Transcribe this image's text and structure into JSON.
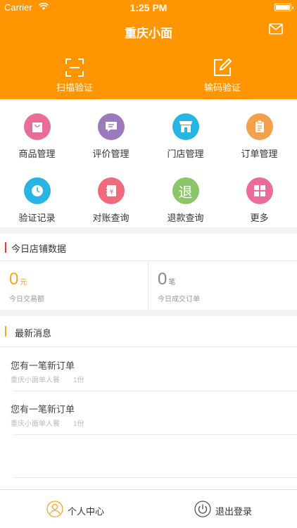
{
  "status_bar": {
    "carrier": "Carrier",
    "time": "1:25 PM"
  },
  "header": {
    "title": "重庆小面",
    "scan_label": "扫描验证",
    "code_label": "输码验证"
  },
  "grid": {
    "items": [
      {
        "label": "商品管理",
        "icon": "bag-icon",
        "color": "#ea6c98"
      },
      {
        "label": "评价管理",
        "icon": "message-icon",
        "color": "#9b79bd"
      },
      {
        "label": "门店管理",
        "icon": "store-icon",
        "color": "#29b5e3"
      },
      {
        "label": "订单管理",
        "icon": "clipboard-icon",
        "color": "#f5a04b"
      },
      {
        "label": "验证记录",
        "icon": "clock-icon",
        "color": "#29b5e3"
      },
      {
        "label": "对账查询",
        "icon": "ledger-icon",
        "color": "#ef6a7a"
      },
      {
        "label": "退款查询",
        "icon": "refund-icon",
        "glyph": "退",
        "color": "#8ac56a"
      },
      {
        "label": "更多",
        "icon": "more-grid-icon",
        "color": "#ea6c98"
      }
    ]
  },
  "today": {
    "title": "今日店铺数据",
    "accent": "#e53935",
    "trade_value": "0",
    "trade_unit": "元",
    "trade_label": "今日交易额",
    "trade_color": "#f5a623",
    "order_value": "0",
    "order_unit": "笔",
    "order_label": "今日成交订单",
    "order_color": "#888888"
  },
  "news": {
    "title": "最新消息",
    "accent": "#f5a623",
    "items": [
      {
        "title": "您有一笔新订单",
        "sub": "重庆小面单人餐",
        "qty": "1份"
      },
      {
        "title": "您有一笔新订单",
        "sub": "重庆小面单人餐",
        "qty": "1份"
      }
    ]
  },
  "tabbar": {
    "profile_label": "个人中心",
    "logout_label": "退出登录"
  },
  "colors": {
    "brand": "#ff9500"
  }
}
